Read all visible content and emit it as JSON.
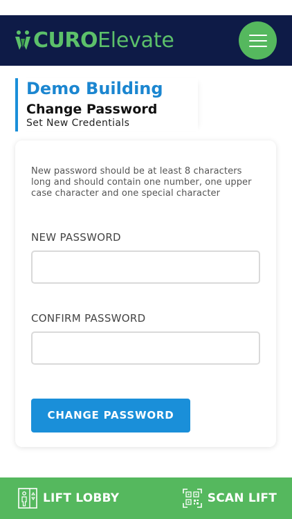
{
  "header": {
    "logo_curo": "CURO",
    "logo_elevate": "Elevate",
    "logo_icon": "curo-logo-icon",
    "menu_icon": "hamburger-icon"
  },
  "page": {
    "building": "Demo Building",
    "title": "Change Password",
    "subtitle": "Set New Credentials"
  },
  "form": {
    "hint": "New password should be at least 8 characters long and should contain one number, one upper case character and one special character",
    "new_password_label": "NEW PASSWORD",
    "new_password_value": "",
    "confirm_password_label": "CONFIRM PASSWORD",
    "confirm_password_value": "",
    "submit_label": "CHANGE PASSWORD"
  },
  "bottom_nav": {
    "lift_lobby_label": "LIFT LOBBY",
    "lift_lobby_icon": "lift-lobby-icon",
    "scan_lift_label": "SCAN LIFT",
    "scan_lift_icon": "qr-scan-icon"
  },
  "colors": {
    "header_bg": "#0e1b47",
    "brand_green": "#55b85e",
    "accent_blue": "#1a8fd9"
  }
}
